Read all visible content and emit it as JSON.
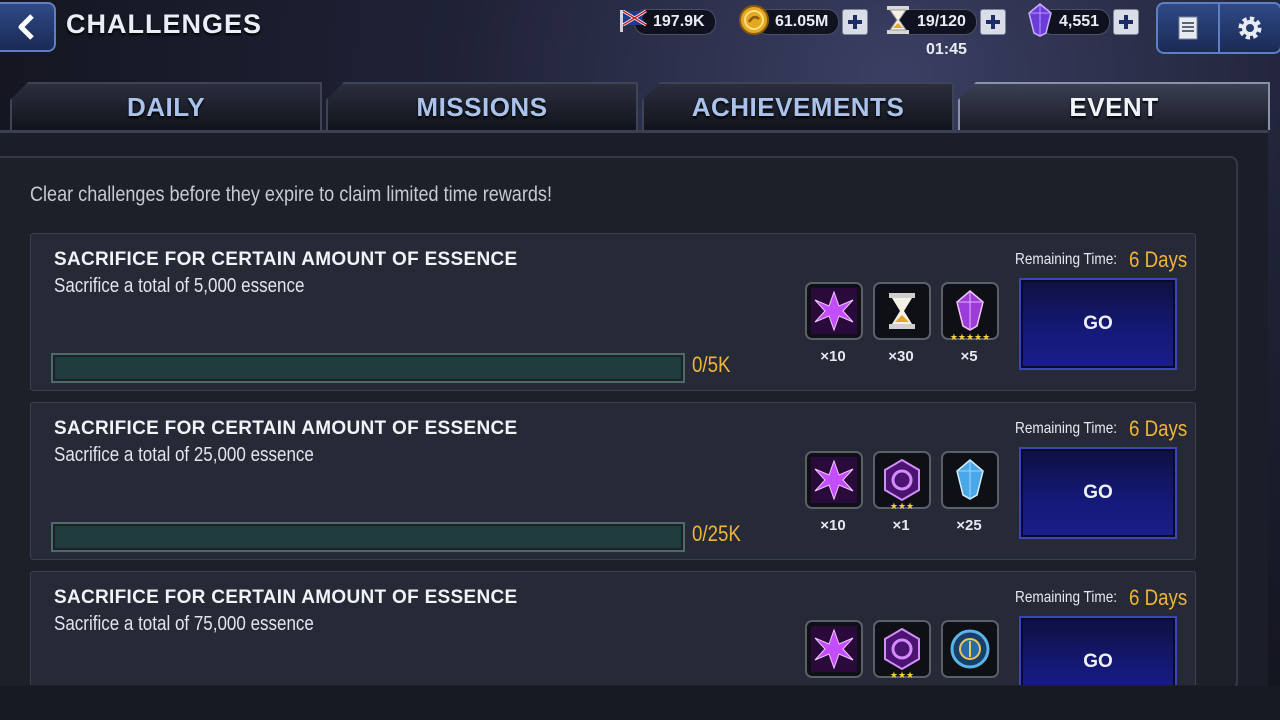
{
  "header": {
    "title": "CHALLENGES",
    "resources": {
      "units": "197.9K",
      "gold": "61.05M",
      "energy": "19/120",
      "energy_timer": "01:45",
      "crystals": "4,551"
    }
  },
  "tabs": [
    {
      "label": "DAILY"
    },
    {
      "label": "MISSIONS"
    },
    {
      "label": "ACHIEVEMENTS"
    },
    {
      "label": "EVENT"
    }
  ],
  "main": {
    "hint": "Clear challenges before they expire to claim limited time rewards!",
    "challenges": [
      {
        "title": "SACRIFICE FOR CERTAIN AMOUNT OF ESSENCE",
        "description": "Sacrifice a total of 5,000 essence",
        "progress_text": "0/5K",
        "progress_fraction": 0,
        "remaining_label": "Remaining Time:",
        "remaining_value": "6 Days",
        "go_label": "GO",
        "rewards": [
          {
            "icon": "purple-essence-icon",
            "qty": "×10",
            "stars": ""
          },
          {
            "icon": "hourglass-icon",
            "qty": "×30",
            "stars": ""
          },
          {
            "icon": "purple-crystal-icon",
            "qty": "×5",
            "stars": "★★★★★"
          }
        ]
      },
      {
        "title": "SACRIFICE FOR CERTAIN AMOUNT OF ESSENCE",
        "description": "Sacrifice a total of 25,000 essence",
        "progress_text": "0/25K",
        "progress_fraction": 0,
        "remaining_label": "Remaining Time:",
        "remaining_value": "6 Days",
        "go_label": "GO",
        "rewards": [
          {
            "icon": "purple-essence-icon",
            "qty": "×10",
            "stars": ""
          },
          {
            "icon": "hex-rune-icon",
            "qty": "×1",
            "stars": "★★★"
          },
          {
            "icon": "blue-crystal-icon",
            "qty": "×25",
            "stars": ""
          }
        ]
      },
      {
        "title": "SACRIFICE FOR CERTAIN AMOUNT OF ESSENCE",
        "description": "Sacrifice a total of 75,000 essence",
        "progress_text": "",
        "progress_fraction": 0,
        "remaining_label": "Remaining Time:",
        "remaining_value": "6 Days",
        "go_label": "GO",
        "rewards": [
          {
            "icon": "purple-essence-icon",
            "qty": "",
            "stars": ""
          },
          {
            "icon": "hex-rune-icon",
            "qty": "",
            "stars": "★★★"
          },
          {
            "icon": "blue-medallion-icon",
            "qty": "",
            "stars": ""
          }
        ]
      }
    ]
  },
  "colors": {
    "accent_gold": "#f0b536",
    "go_button": "#15197a",
    "tab_text": "#a9c3ec"
  }
}
